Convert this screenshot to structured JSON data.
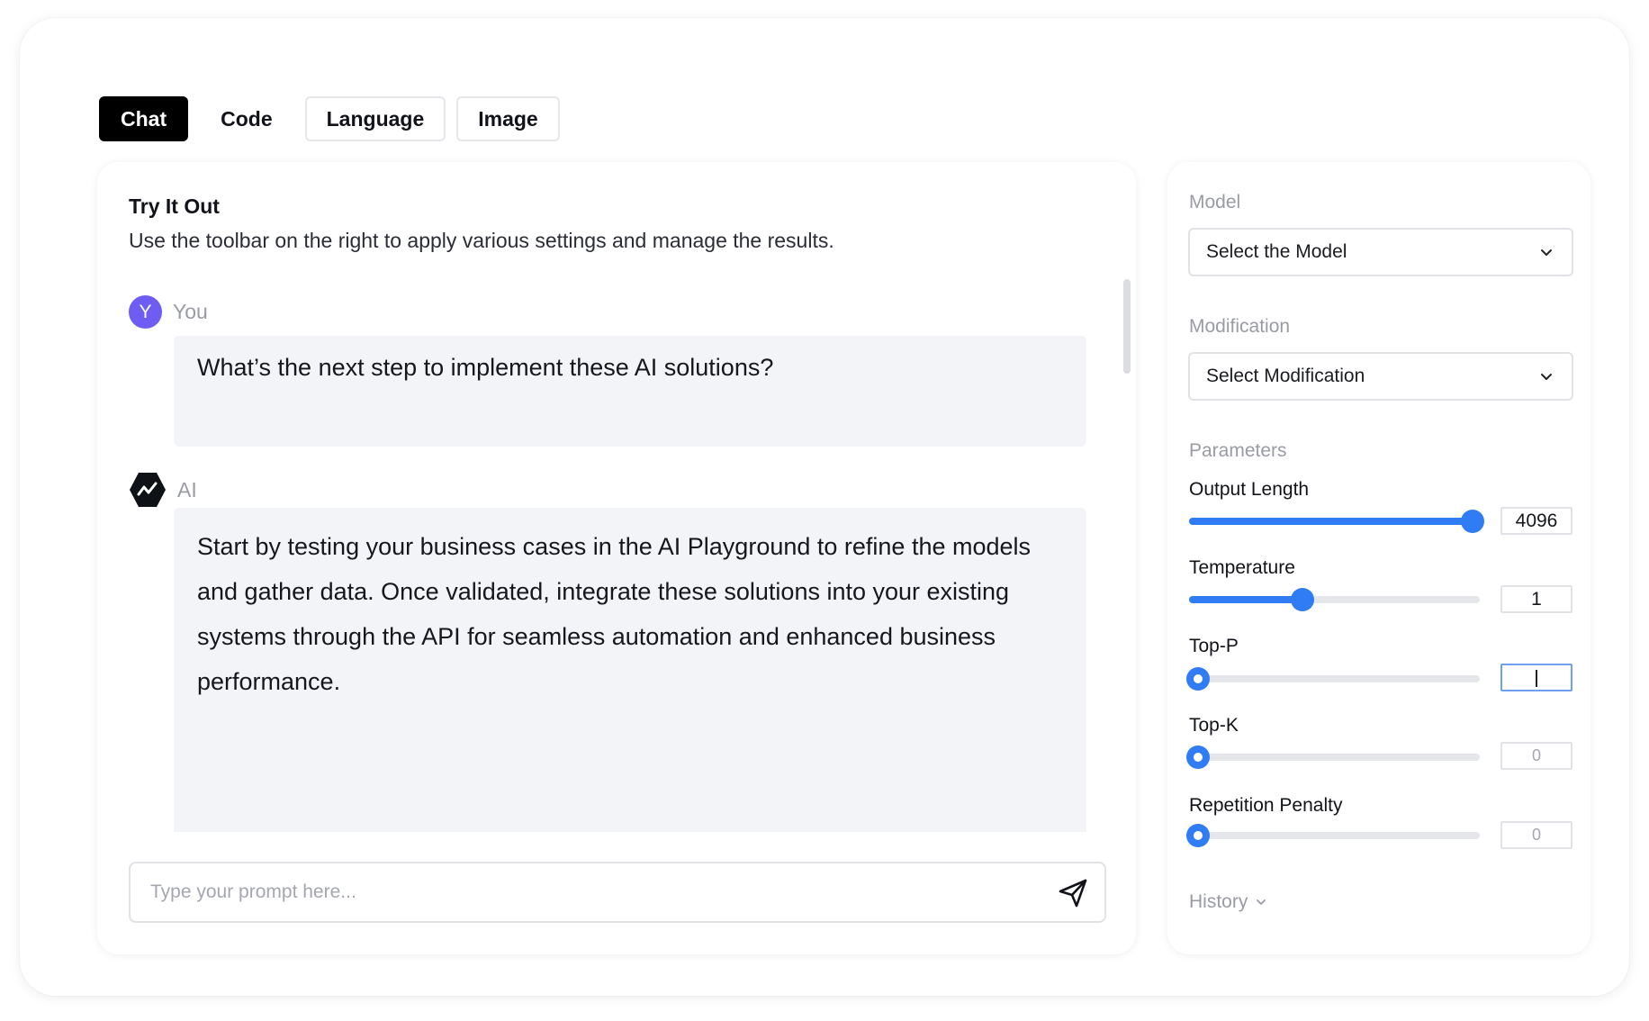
{
  "tabs": [
    {
      "label": "Chat",
      "active": true
    },
    {
      "label": "Code",
      "active": false
    },
    {
      "label": "Language",
      "active": false
    },
    {
      "label": "Image",
      "active": false
    }
  ],
  "chat": {
    "title": "Try It Out",
    "subtitle": "Use the toolbar on the right to apply various settings and manage the results.",
    "user": {
      "avatar_letter": "Y",
      "name": "You",
      "message": "What’s the next step to implement these AI solutions?"
    },
    "ai": {
      "name": "AI",
      "logo_icon": "trend-line-hexagon-icon",
      "message": "Start by testing your business cases in the AI Playground to refine the models and gather data. Once validated, integrate these solutions into your existing systems through the API for seamless automation and enhanced business performance."
    },
    "prompt": {
      "placeholder": "Type your prompt here...",
      "value": ""
    },
    "send_icon": "paper-plane-icon"
  },
  "settings": {
    "model_label": "Model",
    "model_value": "Select the Model",
    "modification_label": "Modification",
    "modification_value": "Select Modification",
    "parameters_label": "Parameters",
    "params": [
      {
        "label": "Output Length",
        "value": "4096",
        "fraction": 1.0
      },
      {
        "label": "Temperature",
        "value": "1",
        "fraction": 0.39
      },
      {
        "label": "Top-P",
        "value": "",
        "fraction": 0.0
      },
      {
        "label": "Top-K",
        "value": "0",
        "fraction": 0.0
      },
      {
        "label": "Repetition Penalty",
        "value": "0",
        "fraction": 0.0
      }
    ],
    "history_label": "History"
  },
  "colors": {
    "accent": "#2f7cf5",
    "avatar": "#6f5cf2",
    "active_tab": "#000000",
    "bubble": "#f3f4f7"
  }
}
